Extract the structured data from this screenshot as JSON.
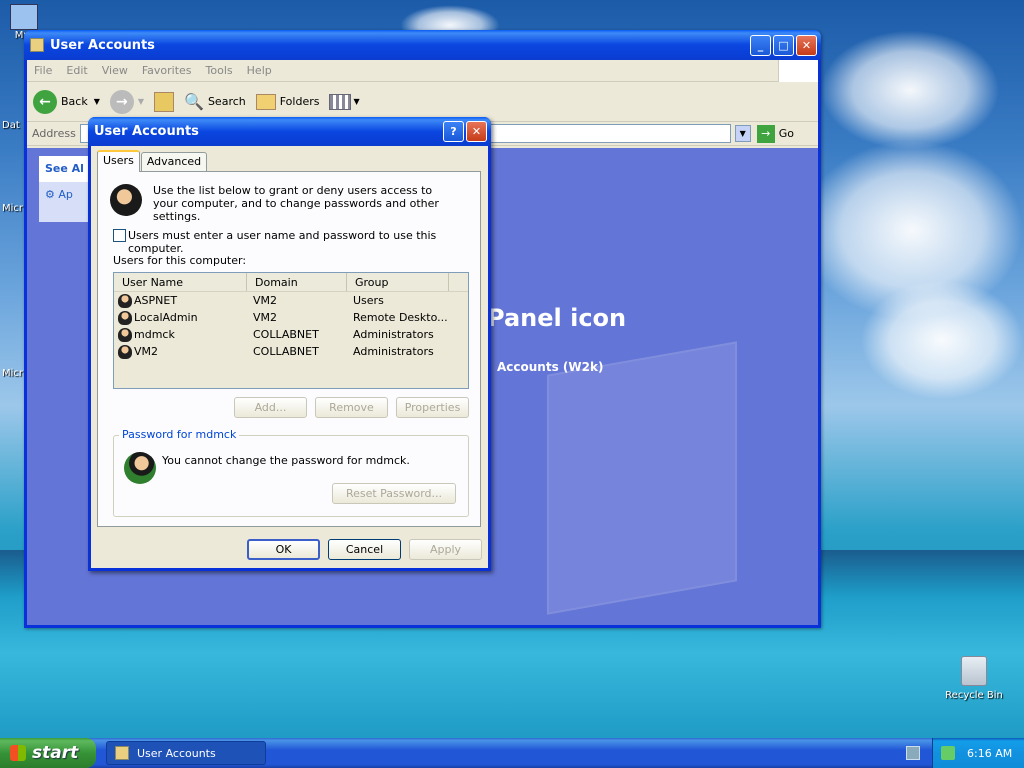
{
  "desktop": {
    "icons": [
      {
        "label": "My"
      },
      {
        "label": "Dat"
      },
      {
        "label": "Micr"
      },
      {
        "label": "Micr"
      },
      {
        "label": "Recycle Bin"
      }
    ]
  },
  "explorer": {
    "title": "User Accounts",
    "menu": [
      "File",
      "Edit",
      "View",
      "Favorites",
      "Tools",
      "Help"
    ],
    "toolbar": {
      "back": "Back",
      "search": "Search",
      "folders": "Folders"
    },
    "address_label": "Address",
    "go_label": "Go",
    "side_panel_title": "See Al",
    "side_panel_item": "Ap",
    "big_title": "Panel icon",
    "subtitle": "Accounts (W2k)"
  },
  "dialog": {
    "title": "User Accounts",
    "tabs": [
      "Users",
      "Advanced"
    ],
    "intro": "Use the list below to grant or deny users access to your computer, and to change passwords and other settings.",
    "checkbox_label": "Users must enter a user name and password to use this computer.",
    "checkbox_checked": false,
    "list_label": "Users for this computer:",
    "columns": [
      "User Name",
      "Domain",
      "Group"
    ],
    "users": [
      {
        "name": "ASPNET",
        "domain": "VM2",
        "group": "Users"
      },
      {
        "name": "LocalAdmin",
        "domain": "VM2",
        "group": "Remote Deskto..."
      },
      {
        "name": "mdmck",
        "domain": "COLLABNET",
        "group": "Administrators"
      },
      {
        "name": "VM2",
        "domain": "COLLABNET",
        "group": "Administrators"
      }
    ],
    "buttons": {
      "add": "Add...",
      "remove": "Remove",
      "properties": "Properties"
    },
    "password_group": "Password for mdmck",
    "password_msg": "You cannot change the password for mdmck.",
    "reset_password": "Reset Password...",
    "ok": "OK",
    "cancel": "Cancel",
    "apply": "Apply"
  },
  "taskbar": {
    "start": "start",
    "task_item": "User Accounts",
    "clock": "6:16 AM"
  }
}
